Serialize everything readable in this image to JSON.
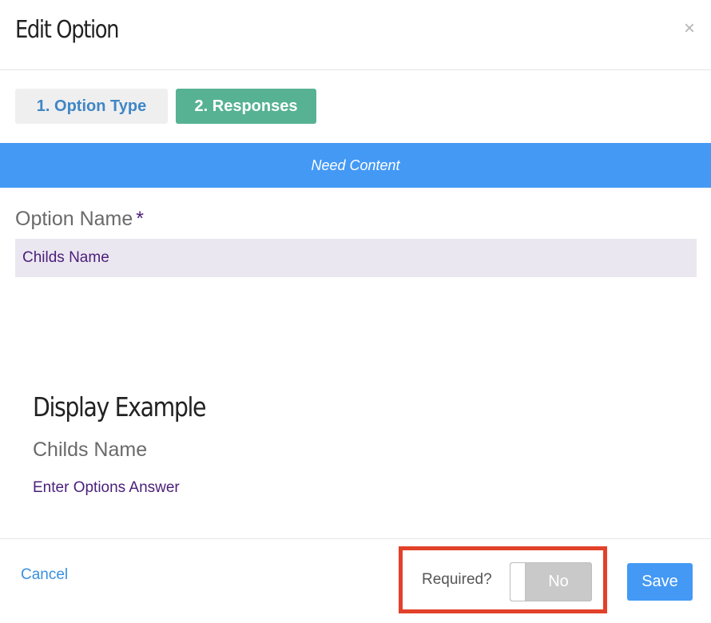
{
  "modal": {
    "title": "Edit Option",
    "close_glyph": "×"
  },
  "tabs": [
    {
      "label": "1. Option Type",
      "active": false
    },
    {
      "label": "2. Responses",
      "active": true
    }
  ],
  "info_bar": {
    "text": "Need Content"
  },
  "option_name": {
    "label": "Option Name",
    "required_mark": "*",
    "value": "Childs Name"
  },
  "display_example": {
    "title": "Display Example",
    "label": "Childs Name",
    "answer_placeholder": "Enter Options Answer"
  },
  "footer": {
    "cancel_label": "Cancel",
    "required_label": "Required?",
    "required_toggle_value": "No",
    "save_label": "Save"
  },
  "colors": {
    "accent": "#4499f5",
    "active_tab": "#57b293",
    "highlight": "#e2412a",
    "text_purple": "#4a1f7a"
  },
  "icons": {
    "close": "close-icon"
  }
}
